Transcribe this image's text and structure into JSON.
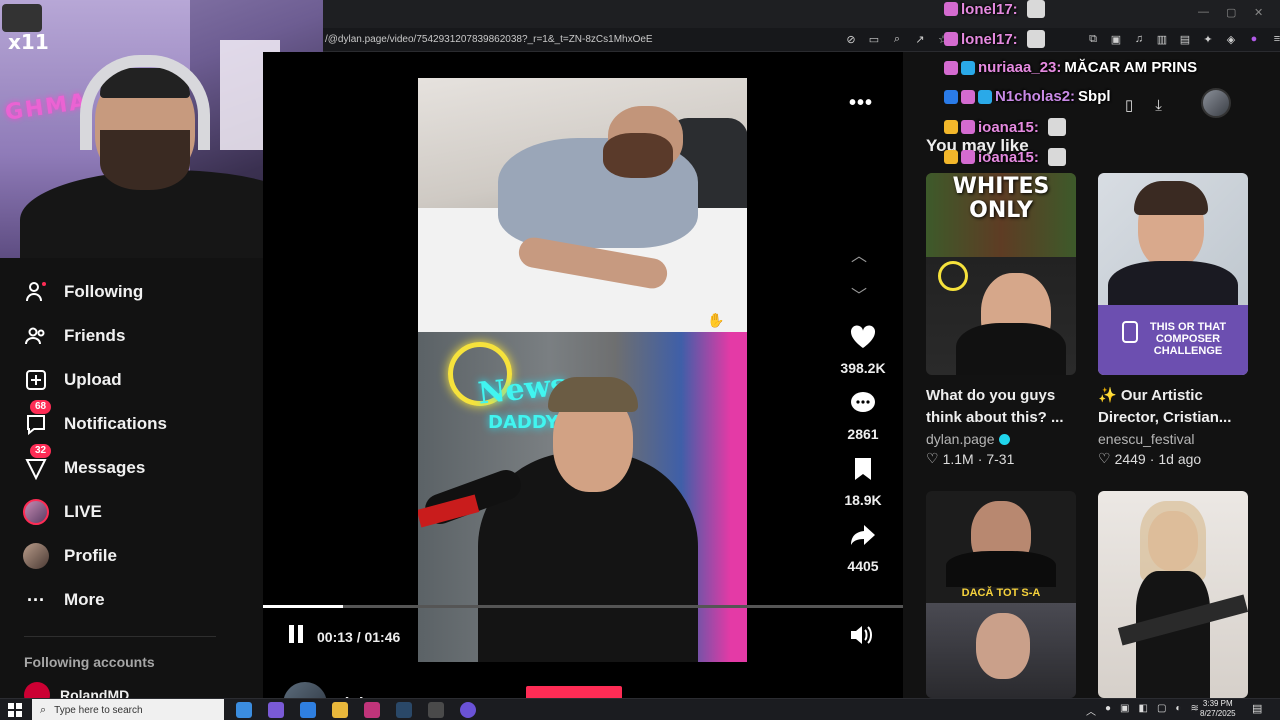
{
  "browser": {
    "url": "/@dylan.page/video/7542931207839862038?_r=1&_t=ZN-8zCs1MhxOeE"
  },
  "webcam": {
    "overlay_text": "x11"
  },
  "sidebar": {
    "items": [
      {
        "label": "Following",
        "icon": "following-icon"
      },
      {
        "label": "Friends",
        "icon": "friends-icon"
      },
      {
        "label": "Upload",
        "icon": "upload-icon"
      },
      {
        "label": "Notifications",
        "icon": "notifications-icon",
        "badge": "68"
      },
      {
        "label": "Messages",
        "icon": "messages-icon",
        "badge": "32"
      },
      {
        "label": "LIVE",
        "icon": "live-icon"
      },
      {
        "label": "Profile",
        "icon": "profile-icon"
      },
      {
        "label": "More",
        "icon": "more-icon"
      }
    ],
    "following_heading": "Following accounts",
    "following_first": "RolandMD"
  },
  "video": {
    "likes": "398.2K",
    "comments": "2861",
    "saves": "18.9K",
    "shares": "4405",
    "time": "00:13 / 01:46",
    "progress": 0.125,
    "author": "dylan.page",
    "overlay_text_1": "News",
    "overlay_text_2": "DADDY"
  },
  "recommendations": {
    "heading": "You may like",
    "cards": [
      {
        "title": "What do you guys think about this? ...",
        "author": "dylan.page",
        "verified": true,
        "likes": "1.1M",
        "date": "7-31",
        "thumb_text": "WHITES ONLY"
      },
      {
        "title": "✨ Our Artistic Director, Cristian...",
        "author": "enescu_festival",
        "verified": false,
        "likes": "2449",
        "date": "1d ago",
        "thumb_text": "THIS OR THAT COMPOSER CHALLENGE"
      },
      {
        "thumb_text": "DACĂ TOT S-A"
      },
      {
        "thumb_text": ""
      }
    ]
  },
  "chat": [
    {
      "user": "lonel17:",
      "msg": "",
      "color": "#e58ae0"
    },
    {
      "user": "lonel17:",
      "msg": "",
      "color": "#e58ae0"
    },
    {
      "user": "nuriaaa_23:",
      "msg": "MĂCAR AM PRINS",
      "color": "#e58ae0"
    },
    {
      "user": "N1cholas2:",
      "msg": "Sbpl",
      "color": "#c98ae6"
    },
    {
      "user": "ioana15:",
      "msg": "",
      "color": "#e58ae0"
    },
    {
      "user": "ioana15:",
      "msg": "",
      "color": "#e58ae0"
    }
  ],
  "taskbar": {
    "search_placeholder": "Type here to search",
    "time": "3:39 PM",
    "date": "8/27/2025"
  },
  "colors": {
    "accent": "#fe2c55",
    "verified": "#20d5ec",
    "composer_purple": "#6c4fb0"
  }
}
